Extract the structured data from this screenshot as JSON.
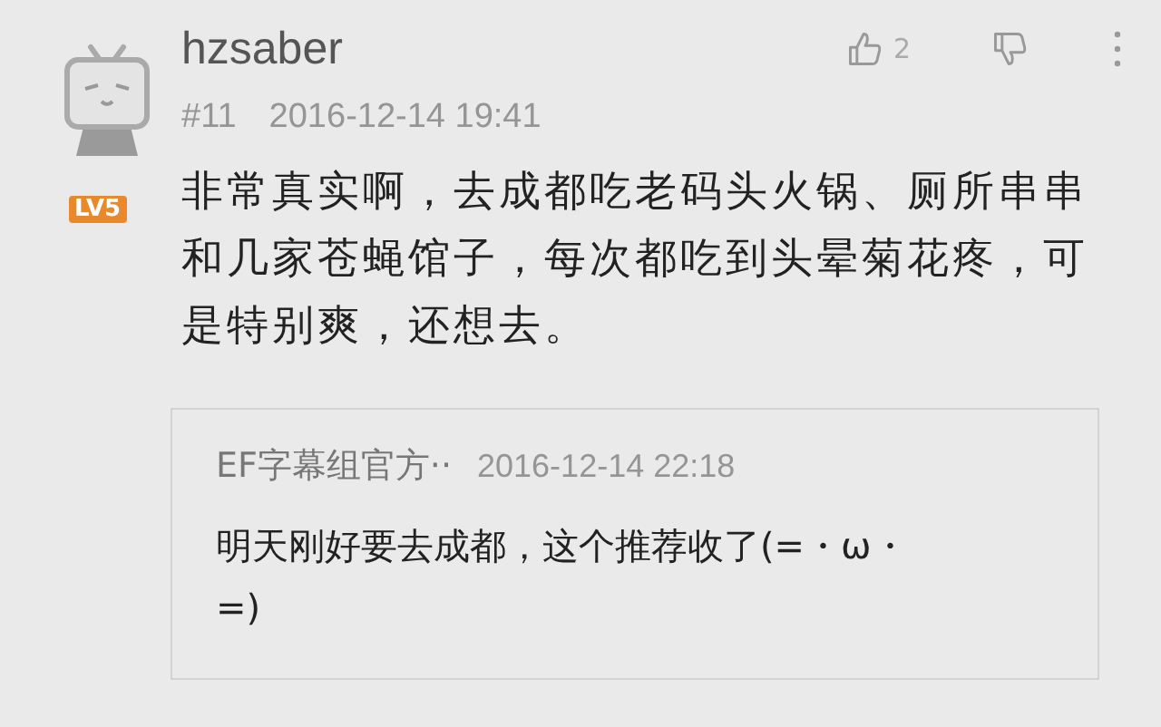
{
  "comment": {
    "username": "hzsaber",
    "level_badge": "LV5",
    "floor": "#11",
    "time": "2016-12-14 19:41",
    "like_count": "2",
    "text": "非常真实啊，去成都吃老码头火锅、厕所串串和几家苍蝇馆子，每次都吃到头晕菊花疼，可是特别爽，还想去。",
    "reply": {
      "username": "EF字幕组官方··",
      "time": "2016-12-14 22:18",
      "text": "明天刚好要去成都，这个推荐收了(=・ω・=)"
    }
  }
}
